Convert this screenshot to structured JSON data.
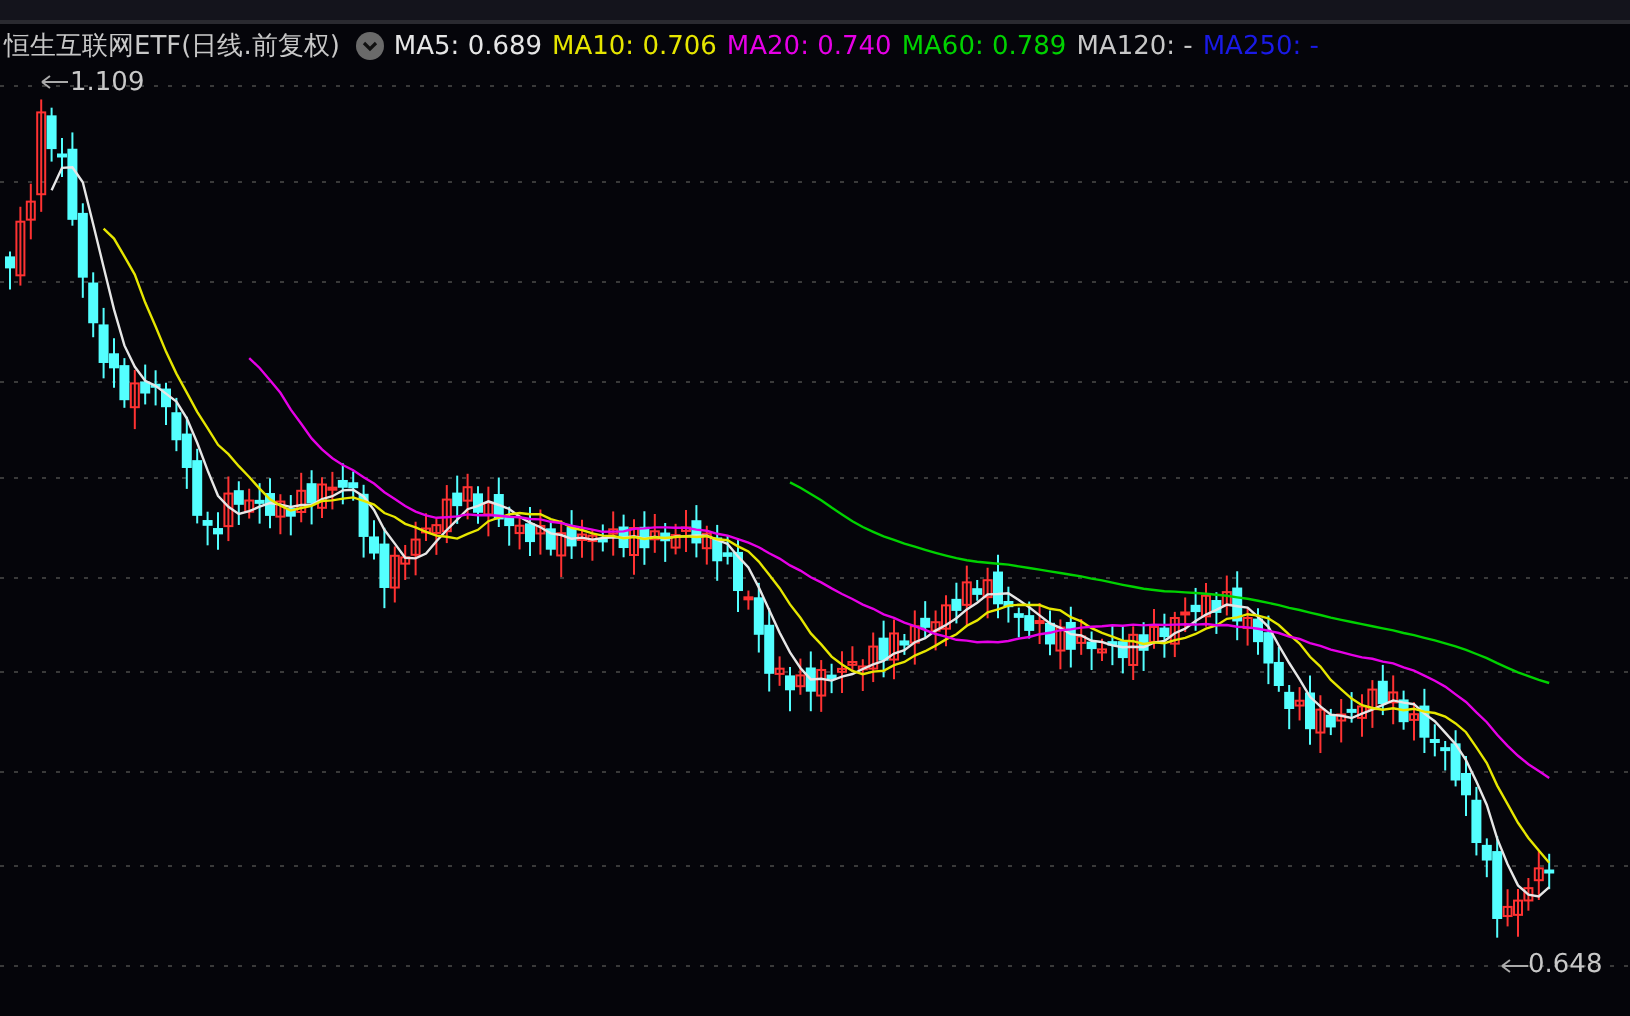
{
  "title": "恒生互联网ETF(日线.前复权)",
  "ma_legend": [
    {
      "label": "MA5: 0.689",
      "color": "#e6e6e6"
    },
    {
      "label": "MA10: 0.706",
      "color": "#e6e600"
    },
    {
      "label": "MA20: 0.740",
      "color": "#e600e6"
    },
    {
      "label": "MA60: 0.789",
      "color": "#00d200"
    },
    {
      "label": "MA120: -",
      "color": "#c8c8c8"
    },
    {
      "label": "MA250: -",
      "color": "#1a1ae6"
    }
  ],
  "chart": {
    "high_label": "1.109",
    "low_label": "0.648"
  }
}
